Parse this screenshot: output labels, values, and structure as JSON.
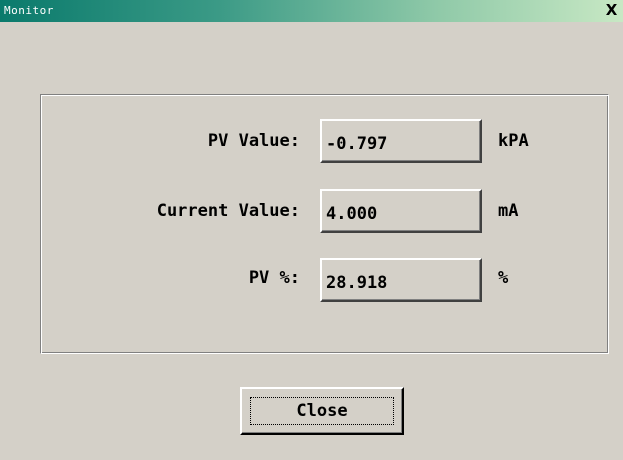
{
  "window": {
    "title": "Monitor",
    "close_glyph": "X"
  },
  "rows": [
    {
      "label": "PV Value:",
      "value": "-0.797",
      "unit": "kPA"
    },
    {
      "label": "Current Value:",
      "value": "4.000",
      "unit": "mA"
    },
    {
      "label": "PV %:",
      "value": "28.918",
      "unit": "%"
    }
  ],
  "buttons": {
    "close_label": "Close"
  },
  "colors": {
    "titlebar_start": "#0a7a6c",
    "titlebar_end": "#c8e8c4",
    "face": "#d4d0c8"
  }
}
